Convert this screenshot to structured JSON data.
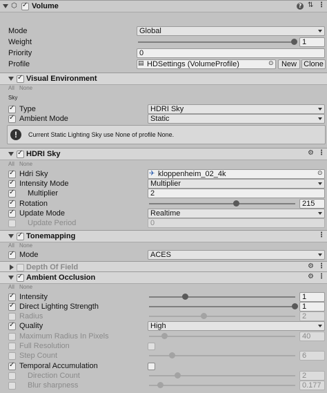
{
  "volume": {
    "title": "Volume",
    "mode_label": "Mode",
    "mode_value": "Global",
    "weight_label": "Weight",
    "weight_value": "1",
    "weight_fraction": 1.0,
    "priority_label": "Priority",
    "priority_value": "0",
    "profile_label": "Profile",
    "profile_value": "HDSettings (VolumeProfile)",
    "new_label": "New",
    "clone_label": "Clone"
  },
  "visual_env": {
    "title": "Visual Environment",
    "all": "All",
    "none": "None",
    "sky_caption": "Sky",
    "type_label": "Type",
    "type_value": "HDRI Sky",
    "ambient_label": "Ambient Mode",
    "ambient_value": "Static",
    "warning": "Current Static Lighting Sky use None of profile None."
  },
  "hdri_sky": {
    "title": "HDRI Sky",
    "all": "All",
    "none": "None",
    "hdri_label": "Hdri Sky",
    "hdri_value": "kloppenheim_02_4k",
    "intensity_mode_label": "Intensity Mode",
    "intensity_mode_value": "Multiplier",
    "multiplier_label": "Multiplier",
    "multiplier_value": "2",
    "rotation_label": "Rotation",
    "rotation_value": "215",
    "rotation_fraction": 0.597,
    "update_mode_label": "Update Mode",
    "update_mode_value": "Realtime",
    "update_period_label": "Update Period",
    "update_period_value": "0"
  },
  "tonemapping": {
    "title": "Tonemapping",
    "all": "All",
    "none": "None",
    "mode_label": "Mode",
    "mode_value": "ACES"
  },
  "dof": {
    "title": "Depth Of Field"
  },
  "ao": {
    "title": "Ambient Occlusion",
    "all": "All",
    "none": "None",
    "intensity_label": "Intensity",
    "intensity_value": "1",
    "intensity_fraction": 0.25,
    "direct_label": "Direct Lighting Strength",
    "direct_value": "1",
    "direct_fraction": 1.0,
    "radius_label": "Radius",
    "radius_value": "2",
    "radius_fraction": 0.375,
    "quality_label": "Quality",
    "quality_value": "High",
    "max_radius_label": "Maximum Radius In Pixels",
    "max_radius_value": "40",
    "max_radius_fraction": 0.11,
    "full_res_label": "Full Resolution",
    "step_count_label": "Step Count",
    "step_count_value": "6",
    "step_count_fraction": 0.16,
    "temporal_label": "Temporal Accumulation",
    "direction_count_label": "Direction Count",
    "direction_count_value": "2",
    "direction_count_fraction": 0.2,
    "blur_label": "Blur sharpness",
    "blur_value": "0.177",
    "blur_fraction": 0.08
  },
  "icons": {
    "collapse": "triangle-down-icon",
    "help": "help-icon",
    "settings": "sliders-icon",
    "menu": "kebab-icon",
    "object_picker": "object-picker-icon",
    "warning": "warning-icon"
  }
}
